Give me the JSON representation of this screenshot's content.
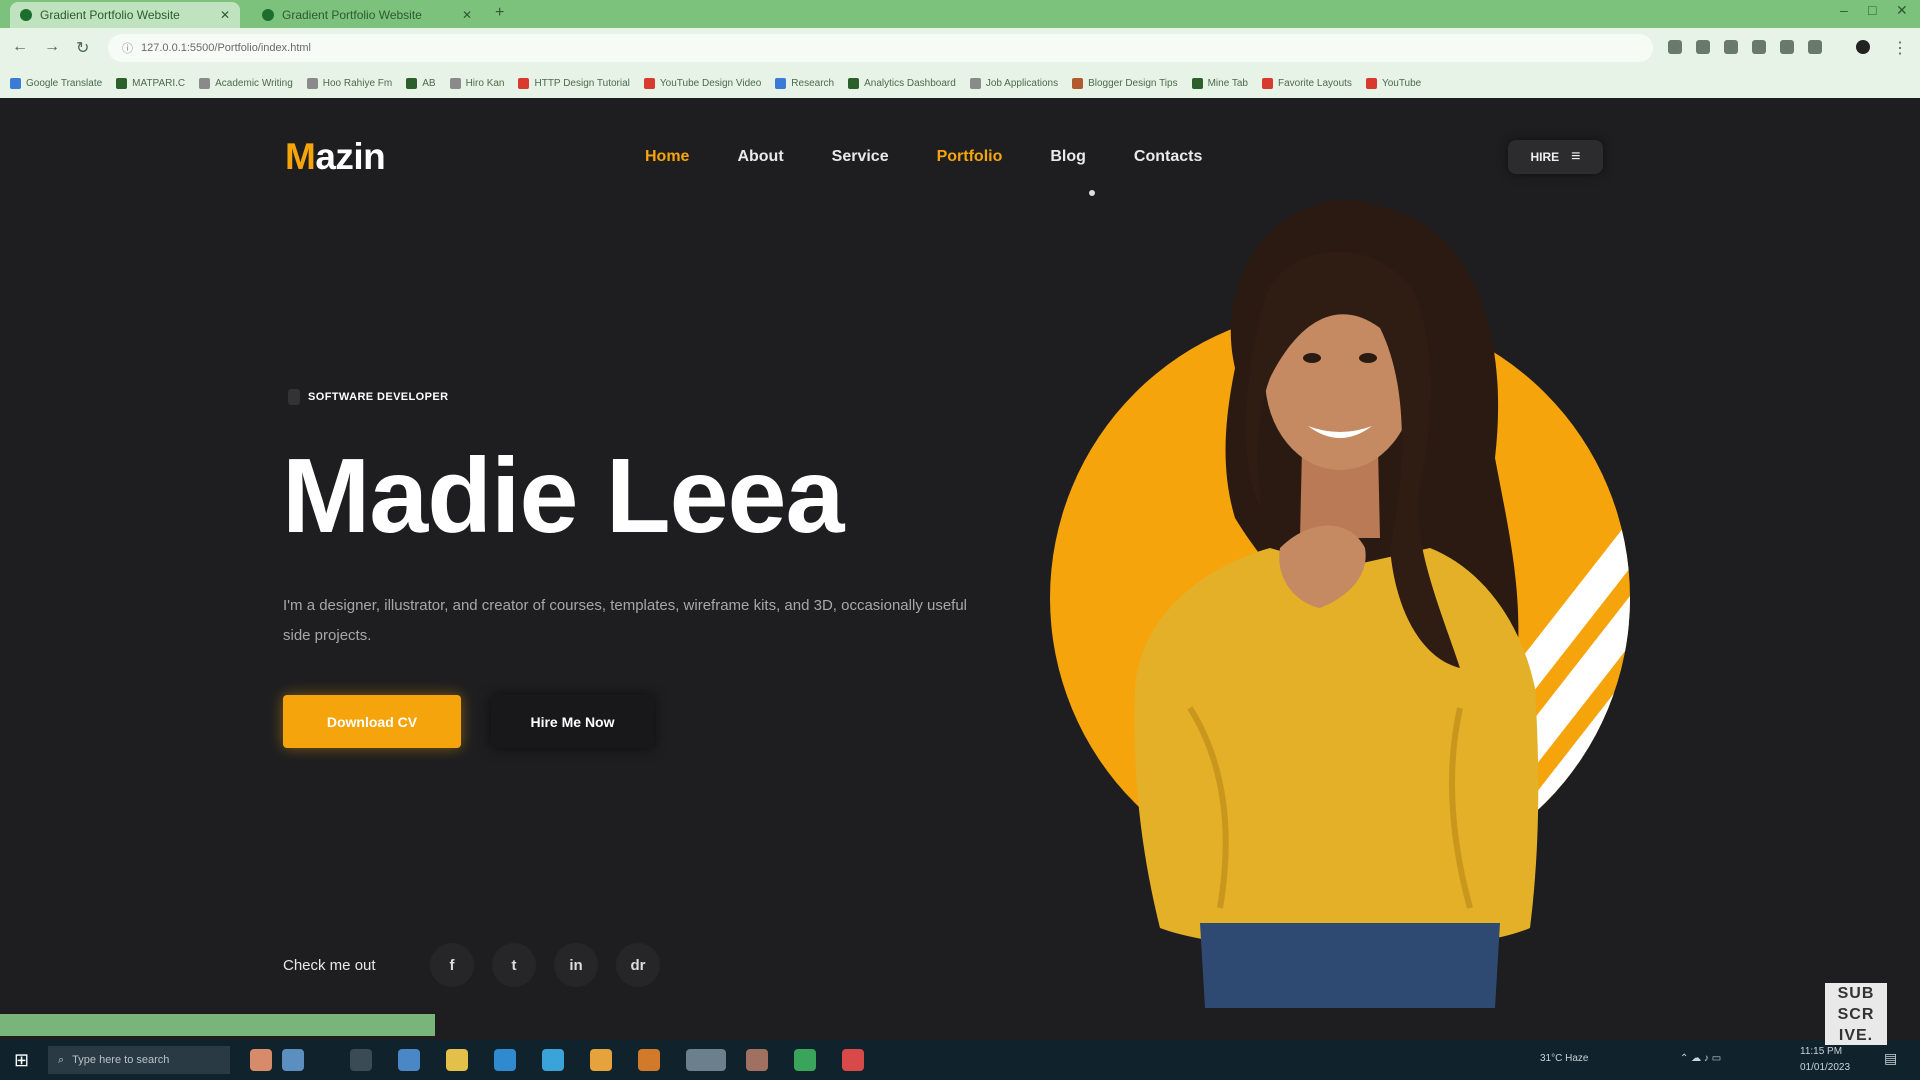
{
  "browser": {
    "tabs": [
      {
        "title": "Gradient Portfolio Website"
      },
      {
        "title": "Gradient Portfolio Website"
      }
    ],
    "new_tab": "+",
    "window_controls": [
      "–",
      "□",
      "✕"
    ],
    "url": "127.0.0.1:5500/Portfolio/index.html"
  },
  "bookmarks": [
    {
      "label": "Google Translate",
      "color": "#3a7bd5"
    },
    {
      "label": "MATPARI.C",
      "color": "#2b5f2b"
    },
    {
      "label": "Academic Writing",
      "color": "#8a8a8a"
    },
    {
      "label": "Hoo Rahiye Fm",
      "color": "#8a8a8a"
    },
    {
      "label": "AB",
      "color": "#2b5f2b"
    },
    {
      "label": "Hiro Kan",
      "color": "#8a8a8a"
    },
    {
      "label": "HTTP Design Tutorial",
      "color": "#d83a2e"
    },
    {
      "label": "YouTube Design Video",
      "color": "#d83a2e"
    },
    {
      "label": "Research",
      "color": "#3a7bd5"
    },
    {
      "label": "Analytics Dashboard",
      "color": "#2b5f2b"
    },
    {
      "label": "Job Applications",
      "color": "#8a8a8a"
    },
    {
      "label": "Blogger Design Tips",
      "color": "#b05a2e"
    },
    {
      "label": "Mine Tab",
      "color": "#2b5f2b"
    },
    {
      "label": "Favorite Layouts",
      "color": "#d83a2e"
    },
    {
      "label": "YouTube",
      "color": "#d83a2e"
    }
  ],
  "site": {
    "logo_initial": "M",
    "logo_rest": "azin",
    "nav": [
      "Home",
      "About",
      "Service",
      "Portfolio",
      "Blog",
      "Contacts"
    ],
    "active_nav": [
      "Home",
      "Portfolio"
    ],
    "hire_button": "HIRE",
    "hire_menu_icon": "≡",
    "badge": "SOFTWARE DEVELOPER",
    "name": "Madie Leea",
    "description": "I'm a designer, illustrator, and creator of courses, templates, wireframe kits, and 3D, occasionally useful side projects.",
    "primary_button": "Download CV",
    "secondary_button": "Hire Me Now",
    "check_label": "Check me out",
    "social_icons": [
      "f",
      "t",
      "in",
      "dr"
    ],
    "accent": "#f5a40c",
    "background": "#1e1e20"
  },
  "taskbar": {
    "search_placeholder": "Type here to search",
    "weather": "31°C Haze",
    "time": "11:15 PM",
    "date": "01/01/2023"
  },
  "overlay": {
    "subscribe": [
      "SUB",
      "SCR",
      "IVE."
    ]
  }
}
